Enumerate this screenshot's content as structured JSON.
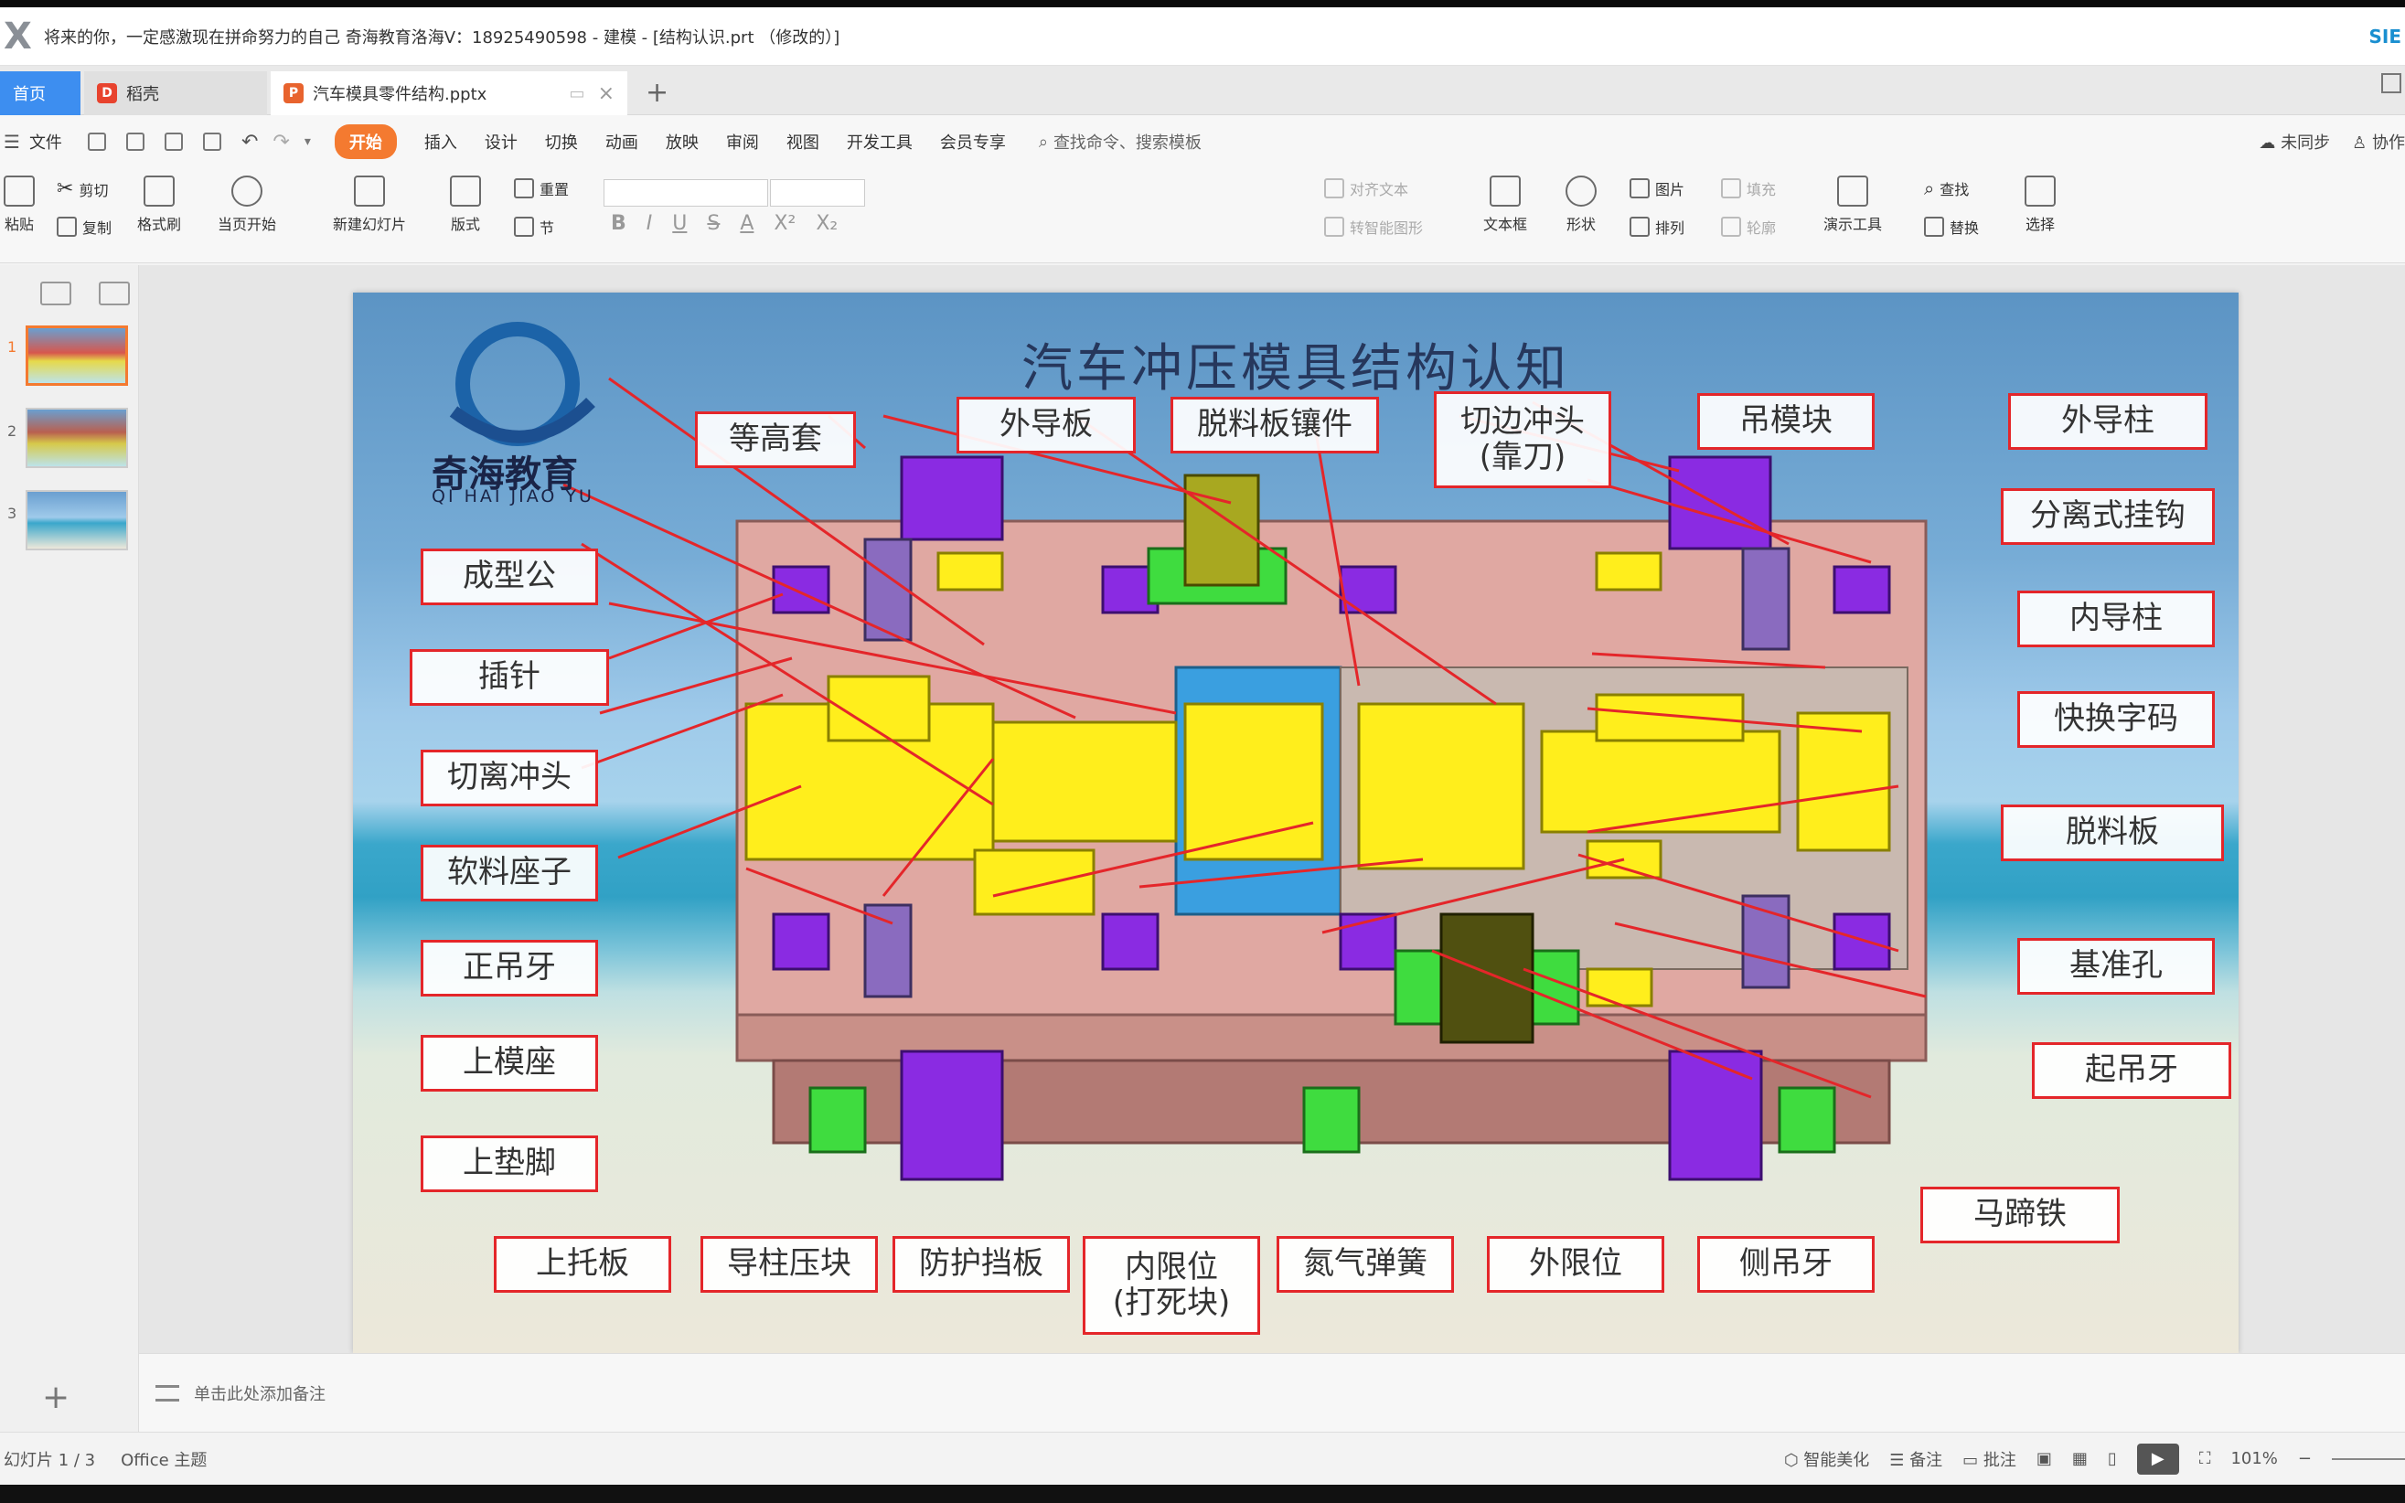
{
  "app": {
    "title": "将来的你，一定感激现在拼命努力的自己 奇海教育洛海V：18925490598 - 建模 - [结构认识.prt （修改的）]",
    "brand": "SIE"
  },
  "tabs": {
    "home": "首页",
    "shell": "稻壳",
    "doc": "汽车模具零件结构.pptx",
    "new_tab": "+"
  },
  "menu": {
    "file": "文件",
    "items": [
      "开始",
      "插入",
      "设计",
      "切换",
      "动画",
      "放映",
      "审阅",
      "视图",
      "开发工具",
      "会员专享"
    ],
    "search": "查找命令、搜索模板",
    "sync": "未同步",
    "collab": "协作"
  },
  "ribbon": {
    "paste": "粘贴",
    "cut": "剪切",
    "copy": "复制",
    "format_painter": "格式刷",
    "from_start": "当页开始",
    "new_slide": "新建幻灯片",
    "layout": "版式",
    "reset": "重置",
    "section": "节",
    "align_text": "对齐文本",
    "smart_shape": "转智能图形",
    "textbox": "文本框",
    "shape": "形状",
    "picture": "图片",
    "arrange": "排列",
    "fill": "填充",
    "outline": "轮廓",
    "present_tools": "演示工具",
    "find": "查找",
    "replace": "替换",
    "select": "选择"
  },
  "slides_panel": {
    "numbers": [
      "1",
      "2",
      "3"
    ]
  },
  "slide": {
    "title": "汽车冲压模具结构认知",
    "logo_text": "奇海教育",
    "logo_sub": "QI HAI JIAO YU",
    "labels": [
      {
        "key": "denggaotao",
        "text": "等高套"
      },
      {
        "key": "waidaoban",
        "text": "外导板"
      },
      {
        "key": "tuoliao_xiangjian",
        "text": "脱料板镶件"
      },
      {
        "key": "qiebian",
        "text": "切边冲头\n(靠刀)"
      },
      {
        "key": "diaomokuai",
        "text": "吊模块"
      },
      {
        "key": "waidaozhu",
        "text": "外导柱"
      },
      {
        "key": "fenli_guagou",
        "text": "分离式挂钩"
      },
      {
        "key": "neidaozhu",
        "text": "内导柱"
      },
      {
        "key": "kuaihuan",
        "text": "快换字码"
      },
      {
        "key": "tuoliaoban",
        "text": "脱料板"
      },
      {
        "key": "jizhunkong",
        "text": "基准孔"
      },
      {
        "key": "qidiaoya",
        "text": "起吊牙"
      },
      {
        "key": "matitie",
        "text": "马蹄铁"
      },
      {
        "key": "cediaoya",
        "text": "侧吊牙"
      },
      {
        "key": "waixianwei",
        "text": "外限位"
      },
      {
        "key": "danqi_tanhuang",
        "text": "氮气弹簧"
      },
      {
        "key": "neixianwei",
        "text": "内限位\n(打死块)"
      },
      {
        "key": "fanghu_dangban",
        "text": "防护挡板"
      },
      {
        "key": "daozhu_yakuai",
        "text": "导柱压块"
      },
      {
        "key": "shangtuoban",
        "text": "上托板"
      },
      {
        "key": "shangdianjiao",
        "text": "上垫脚"
      },
      {
        "key": "shangmozuo",
        "text": "上模座"
      },
      {
        "key": "zhengdiaoya",
        "text": "正吊牙"
      },
      {
        "key": "ruanliao_zuozi",
        "text": "软料座子"
      },
      {
        "key": "qieli_chongtou",
        "text": "切离冲头"
      },
      {
        "key": "chazhen",
        "text": "插针"
      },
      {
        "key": "chengxinggong",
        "text": "成型公"
      }
    ]
  },
  "notes": {
    "placeholder": "单击此处添加备注"
  },
  "status": {
    "slide_info": "幻灯片 1 / 3",
    "theme": "Office 主题",
    "beautify": "智能美化",
    "notes": "备注",
    "comments": "批注",
    "zoom": "101%"
  },
  "colors": {
    "accent": "#f47a30",
    "label_border": "#e4262a",
    "die_base": "#e0a8a2",
    "part_yellow": "#ffee1c",
    "part_purple": "#8a2be2",
    "part_green": "#3fdc3f",
    "part_blue": "#3a9fe0"
  }
}
